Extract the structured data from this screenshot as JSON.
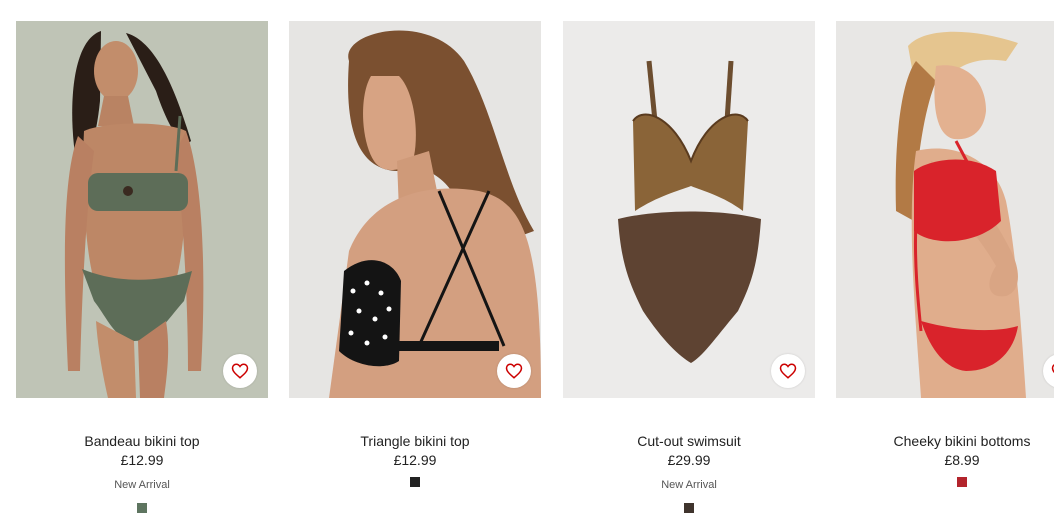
{
  "products": [
    {
      "title": "Bandeau bikini top",
      "price": "£12.99",
      "badge": "New Arrival",
      "swatch_color": "#5e7560",
      "image_bg": "#bfc4b6",
      "favorite_icon": "heart-icon"
    },
    {
      "title": "Triangle bikini top",
      "price": "£12.99",
      "badge": "",
      "swatch_color": "#222222",
      "image_bg": "#e6e5e3",
      "favorite_icon": "heart-icon"
    },
    {
      "title": "Cut-out swimsuit",
      "price": "£29.99",
      "badge": "New Arrival",
      "swatch_color": "#3f342d",
      "image_bg": "#ecebea",
      "favorite_icon": "heart-icon"
    },
    {
      "title": "Cheeky bikini bottoms",
      "price": "£8.99",
      "badge": "",
      "swatch_color": "#b3242c",
      "image_bg": "#e8e7e5",
      "favorite_icon": "heart-icon"
    }
  ],
  "colors": {
    "heart": "#cc0000",
    "text": "#222222"
  }
}
